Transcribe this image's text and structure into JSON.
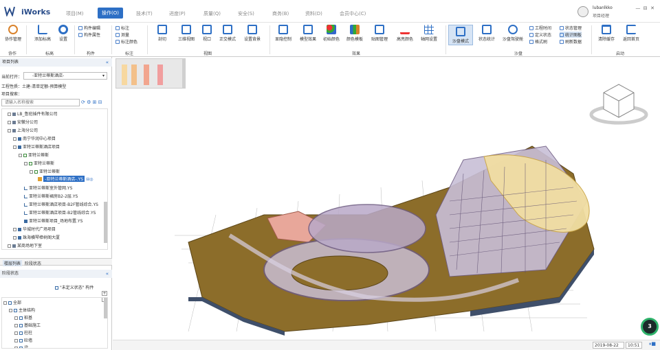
{
  "app": {
    "name": "iWorks",
    "logo_icon": "iworks-logo-icon"
  },
  "tabs": [
    {
      "label": "项目(M)",
      "active": false
    },
    {
      "label": "操作(O)",
      "active": true
    },
    {
      "label": "技术(T)",
      "active": false
    },
    {
      "label": "进度(P)",
      "active": false
    },
    {
      "label": "质量(Q)",
      "active": false
    },
    {
      "label": "安全(S)",
      "active": false
    },
    {
      "label": "商务(B)",
      "active": false
    },
    {
      "label": "资料(D)",
      "active": false
    },
    {
      "label": "会员中心(C)",
      "active": false
    }
  ],
  "user": {
    "name": "lubanlkko",
    "role": "项目经理"
  },
  "window": {
    "min": "—",
    "restore": "⊟",
    "close": "✕"
  },
  "ribbon": {
    "collab": {
      "label": "协作管理",
      "group": "协作"
    },
    "mark": {
      "add": "添加标高",
      "settings": "设置",
      "group": "标高"
    },
    "component": {
      "edit": "构件编辑",
      "props": "构件属性",
      "group": "构件"
    },
    "annotate": {
      "mark": "标注",
      "measure": "测量",
      "color": "标注颜色",
      "group": "标注"
    },
    "view": {
      "section": "剖切",
      "views3d": "三维视图",
      "viewport": "视口",
      "ortho": "正交模式",
      "bg": "设置背景",
      "group": "视图"
    },
    "effect": {
      "hide": "显隐控制",
      "model": "模型效果",
      "init_color": "初始颜色",
      "color_tpl": "颜色模板",
      "texture": "贴图管理",
      "highlight": "高亮颜色",
      "axis": "轴网设置",
      "group": "效果"
    },
    "sandbox": {
      "mode": "沙盘模式",
      "stats": "状态统计",
      "roam": "沙盘驾驶舱",
      "work_time": "工程时间",
      "def_status": "定义状态",
      "format": "格式刷",
      "status_mgr": "状态管理",
      "stat_chart": "统计图板",
      "refresh": "刷新数据",
      "group": "沙盘"
    },
    "launch": {
      "clear": "清除缓存",
      "home": "返回首页",
      "group": "启动"
    }
  },
  "project_panel": {
    "title": "项目列表",
    "collapse": "«",
    "current_open_label": "当前打开：",
    "current_open_value": "-亚特兰蒂斯酒店-",
    "props_line": "工程性质：土建-清单定额-预算模型",
    "search_label": "项目搜索：",
    "search_placeholder": "请输入名称搜索",
    "tree": [
      {
        "label": "LB_鲁班插件有限公司",
        "level": 0
      },
      {
        "label": "安徽分公司",
        "level": 0
      },
      {
        "label": "上海分公司",
        "level": 0
      },
      {
        "label": "南宁华润中心项目",
        "level": 1
      },
      {
        "label": "亚特兰蒂斯酒店项目",
        "level": 1
      },
      {
        "label": "亚特兰蒂斯",
        "level": 2
      },
      {
        "label": "亚特兰蒂斯",
        "level": 3
      },
      {
        "label": "亚特兰蒂斯",
        "level": 4
      },
      {
        "label": "-亚特兰蒂斯酒店-.YS",
        "level": 5,
        "selected": true
      },
      {
        "label": "亚特兰蒂斯室外管网.YS",
        "level": 2
      },
      {
        "label": "亚特兰蒂斯裙房B2-2层.YS",
        "level": 2
      },
      {
        "label": "亚特兰蒂斯酒店项目-B2F管线综合.YS",
        "level": 2
      },
      {
        "label": "亚特兰蒂斯酒店项目-B2管线综合.YS",
        "level": 2
      },
      {
        "label": "亚特兰蒂斯项目_场地布置.YS",
        "level": 2
      },
      {
        "label": "华城时代广场项目",
        "level": 1
      },
      {
        "label": "珠海横琴樟树阁大厦",
        "level": 1
      },
      {
        "label": "某商场地下室",
        "level": 0
      }
    ]
  },
  "stage_panel": {
    "tab1": "楼层列表",
    "tab2": "阶段状态",
    "title": "阶段状态",
    "collapse": "«",
    "undefined_status": "\"未定义状态\" 构件",
    "plus": "+",
    "minus": "-",
    "tree": [
      {
        "label": "全部",
        "level": 0
      },
      {
        "label": "主体结构",
        "level": 1
      },
      {
        "label": "桩基",
        "level": 2
      },
      {
        "label": "基础施工",
        "level": 2
      },
      {
        "label": "柱柱",
        "level": 2
      },
      {
        "label": "砼墙",
        "level": 2
      },
      {
        "label": "梁",
        "level": 2
      }
    ]
  },
  "legend": {
    "swatches": [
      "#f7d8a0",
      "#f3c08a",
      "#f2a58e",
      "#f19e9e"
    ]
  },
  "status": {
    "date": "2019-08-22",
    "time": "10:51"
  },
  "badge": {
    "text": "3"
  },
  "colors": {
    "accent": "#2d6fc5",
    "select": "#2d6fc5",
    "model_brown": "#8c6d2a",
    "badge_ring": "#2fb36b"
  }
}
